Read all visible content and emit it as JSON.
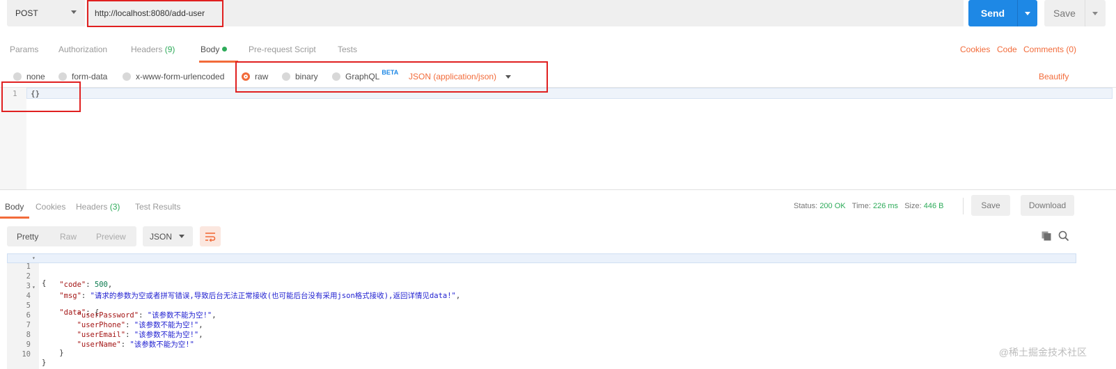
{
  "request": {
    "method": "POST",
    "url": "http://localhost:8080/add-user",
    "send_label": "Send",
    "save_label": "Save"
  },
  "request_tabs": {
    "params": "Params",
    "authorization": "Authorization",
    "headers": "Headers",
    "headers_count": "(9)",
    "body": "Body",
    "prerequest": "Pre-request Script",
    "tests": "Tests",
    "cookies": "Cookies",
    "code": "Code",
    "comments": "Comments (0)"
  },
  "body_options": {
    "none": "none",
    "form_data": "form-data",
    "urlencoded": "x-www-form-urlencoded",
    "raw": "raw",
    "binary": "binary",
    "graphql": "GraphQL",
    "beta": "BETA",
    "content_type": "JSON (application/json)",
    "beautify": "Beautify",
    "selected": "raw"
  },
  "request_editor": {
    "line_number": "1",
    "content": "{}"
  },
  "response_tabs": {
    "body": "Body",
    "cookies": "Cookies",
    "headers": "Headers",
    "headers_count": "(3)",
    "test_results": "Test Results"
  },
  "response_status": {
    "status_label": "Status:",
    "status_value": "200 OK",
    "time_label": "Time:",
    "time_value": "226 ms",
    "size_label": "Size:",
    "size_value": "446 B",
    "save_label": "Save",
    "download_label": "Download"
  },
  "response_toolbar": {
    "pretty": "Pretty",
    "raw": "Raw",
    "preview": "Preview",
    "format": "JSON"
  },
  "response_body": [
    {
      "n": "1",
      "fold": true
    },
    {
      "n": "2"
    },
    {
      "n": "3"
    },
    {
      "n": "4",
      "fold": true
    },
    {
      "n": "5"
    },
    {
      "n": "6"
    },
    {
      "n": "7"
    },
    {
      "n": "8"
    },
    {
      "n": "9"
    },
    {
      "n": "10"
    }
  ],
  "response_json": {
    "code_key": "\"code\"",
    "code_val": "500",
    "msg_key": "\"msg\"",
    "msg_val": "\"请求的参数为空或者拼写错误,导致后台无法正常接收(也可能后台没有采用json格式接收),返回详情见data!\"",
    "data_key": "\"data\"",
    "pw_key": "\"userPassword\"",
    "pw_val": "\"该参数不能为空!\"",
    "phone_key": "\"userPhone\"",
    "phone_val": "\"该参数不能为空!\"",
    "email_key": "\"userEmail\"",
    "email_val": "\"该参数不能为空!\"",
    "name_key": "\"userName\"",
    "name_val": "\"该参数不能为空!\""
  },
  "watermark": "@稀土掘金技术社区",
  "colors": {
    "accent": "#f26b3a",
    "send": "#1e88e5",
    "success": "#2eab5a",
    "annotation": "#e02020"
  }
}
